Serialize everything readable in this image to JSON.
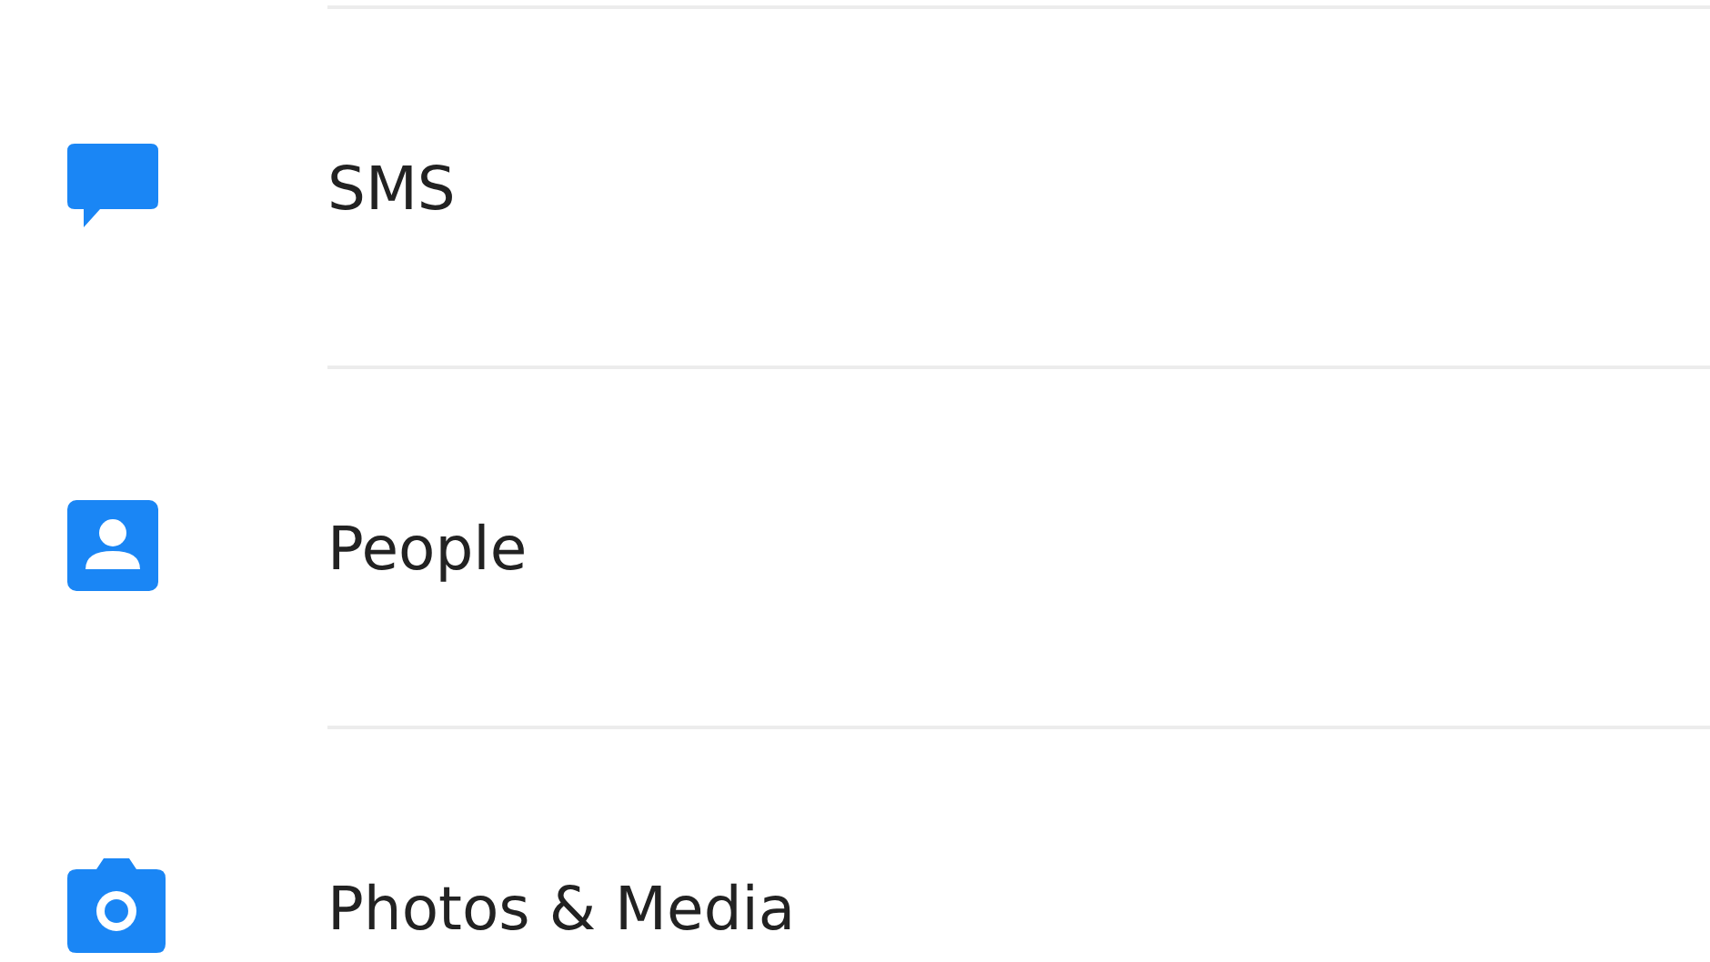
{
  "items": [
    {
      "kind": "message",
      "label": "SMS"
    },
    {
      "kind": "contact",
      "label": "People"
    },
    {
      "kind": "camera",
      "label": "Photos & Media"
    }
  ]
}
